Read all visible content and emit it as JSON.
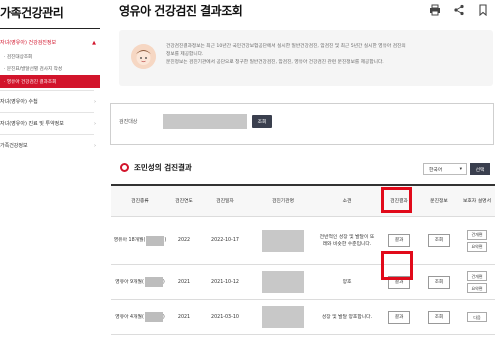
{
  "sidebar": {
    "title": "가족건강관리",
    "items": [
      {
        "label": "자녀(영유아) 건강검진정보",
        "chev": "▲",
        "active": true
      },
      {
        "label": "자녀(영유아) 수첩",
        "chev": "›"
      },
      {
        "label": "자녀(영유아) 진료 및 투약정보",
        "chev": "›"
      },
      {
        "label": "가족건강정보",
        "chev": "›"
      }
    ],
    "sub_items": [
      {
        "label": "· 검진대상조회"
      },
      {
        "label": "· 문진표/발달선별 검사지 작성"
      },
      {
        "label": "· 영유아 건강검진 결과조회",
        "on": true
      }
    ]
  },
  "header": {
    "title": "영유아 건강검진 결과조회",
    "icons": [
      "print-icon",
      "share-icon",
      "bookmark-icon"
    ]
  },
  "info": {
    "lines": [
      "건강검진결과정보는 최근 10년간 국민건강보험공단에서 실시한 일반건강검진, 암검진 및 최근 5년간 실시한 영유아 검진의",
      "정보를 제공합니다.",
      "문진정보는 검진기관에서 공단으로 청구한 일반건강검진, 암검진, 영유아 건강검진 관련 문진정보를 제공합니다."
    ]
  },
  "search": {
    "label": "검진대상",
    "button": "조회"
  },
  "section": {
    "title": "조민성의 검진결과",
    "lang_value": "한국어",
    "lang_button": "선택"
  },
  "table": {
    "headers": [
      "검진종류",
      "검진연도",
      "검진일자",
      "검진기관명",
      "소견",
      "검진결과",
      "문진정보",
      "보호자 설명서"
    ],
    "rows": [
      {
        "type": "영유아 18개월(",
        "year": "2022",
        "date": "2022-10-17",
        "opinion": "전반적인 성장 및 발달이 또래와 비슷한 수준입니다.",
        "result": "결과",
        "survey": "조회",
        "guide": [
          "건개편",
          "요약편"
        ]
      },
      {
        "type": "영유아 9개월(",
        "year": "2021",
        "date": "2021-10-12",
        "opinion": "양호",
        "result": "결과",
        "survey": "조회",
        "guide": [
          "건개편",
          "요약편"
        ]
      },
      {
        "type": "영유아 4개월(",
        "year": "2021",
        "date": "2021-03-10",
        "opinion": "성장 및 발달 양호합니다.",
        "result": "결과",
        "survey": "조회",
        "guide": [
          "다음"
        ]
      }
    ]
  },
  "colors": {
    "accent": "#d2142b",
    "highlight": "#e10a1a",
    "dark_button": "#3a3f4e"
  }
}
